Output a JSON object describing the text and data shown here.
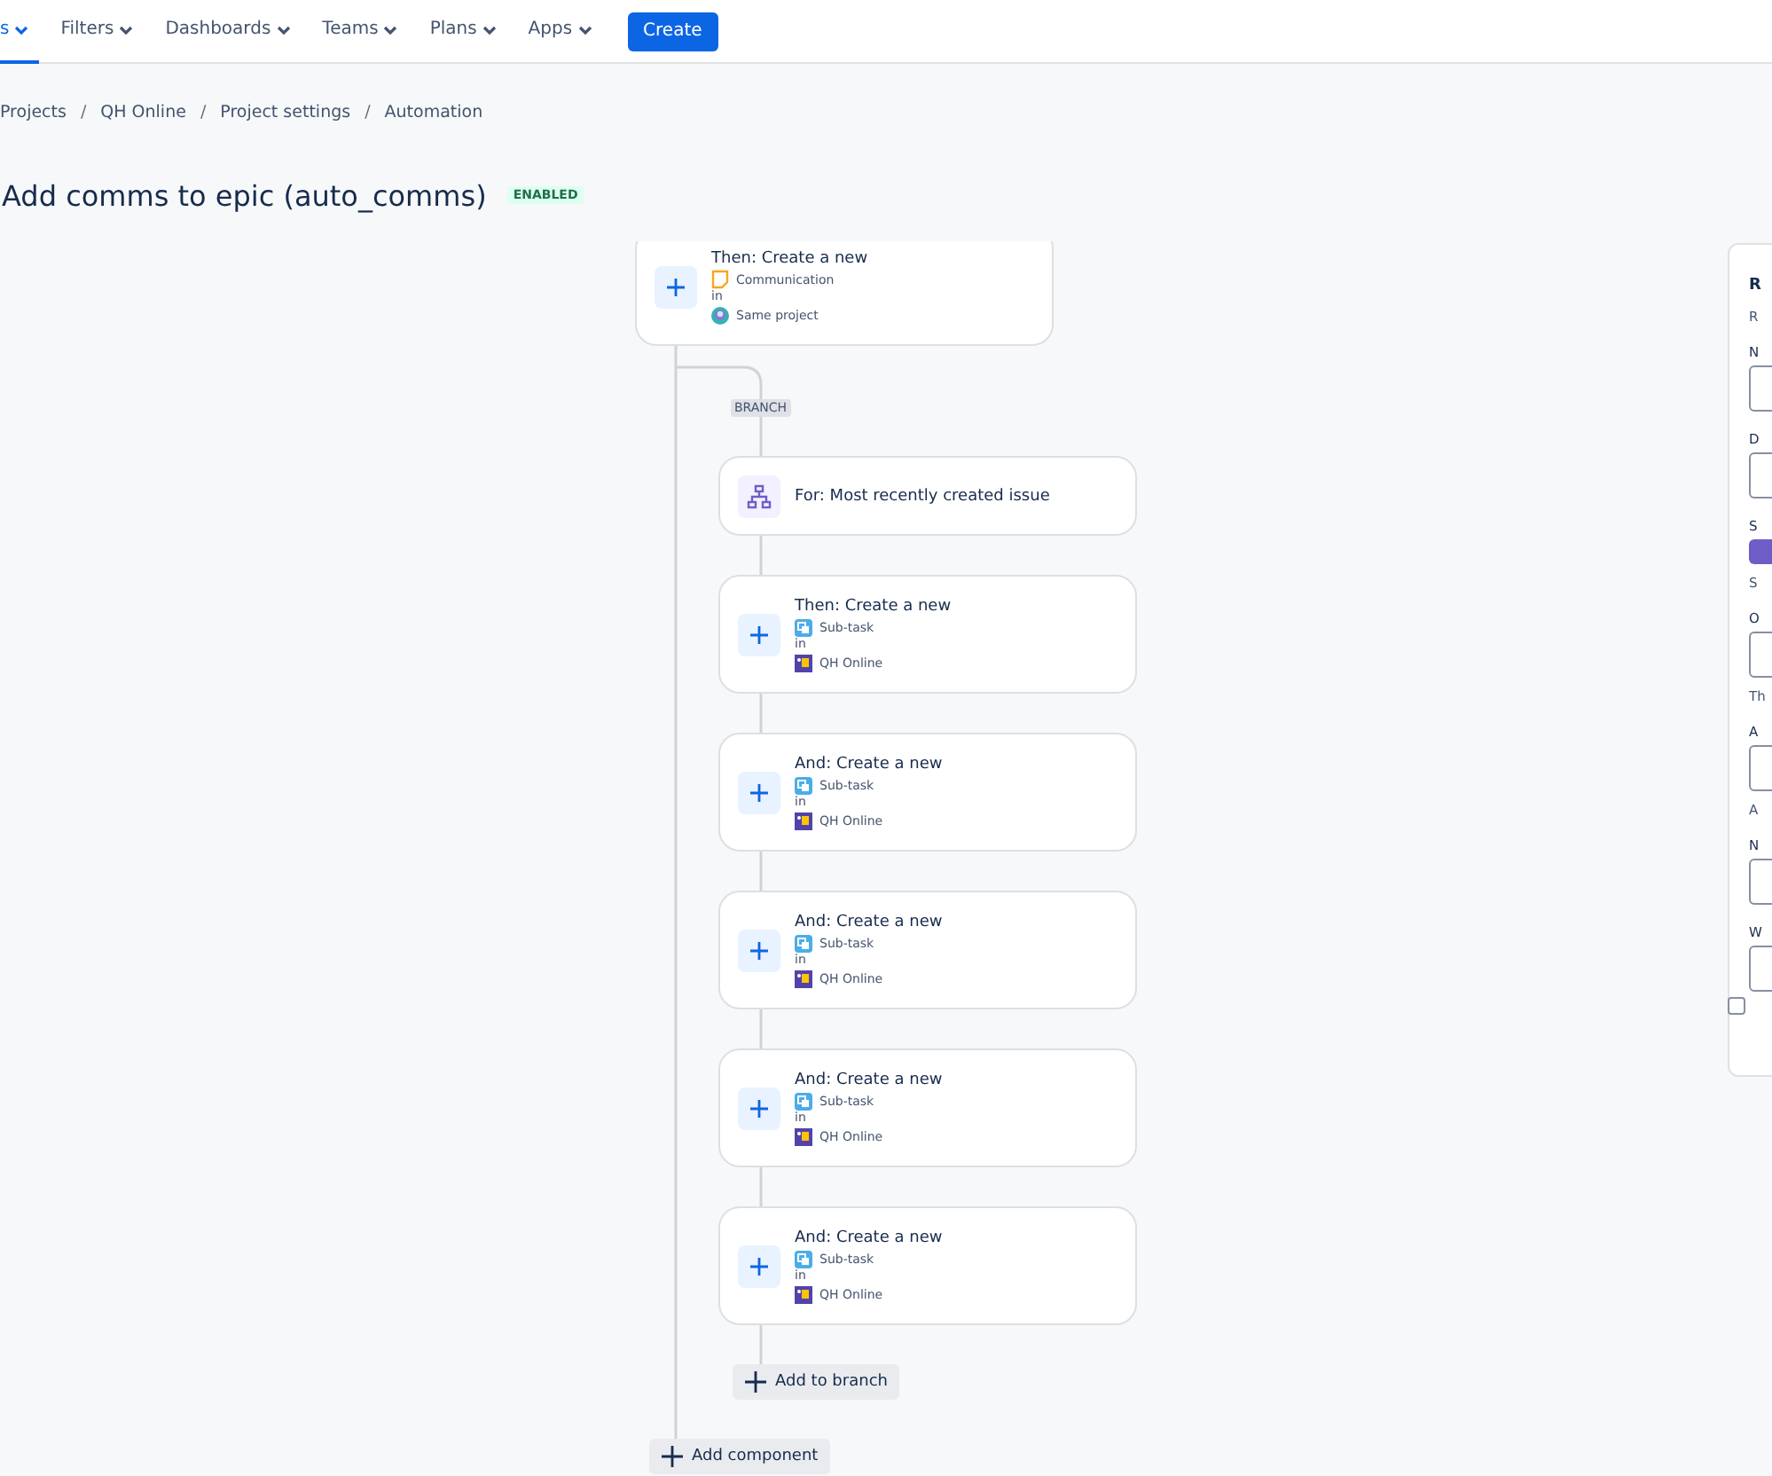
{
  "nav": {
    "items": [
      {
        "label": "s",
        "selected": true
      },
      {
        "label": "Filters",
        "selected": false
      },
      {
        "label": "Dashboards",
        "selected": false
      },
      {
        "label": "Teams",
        "selected": false
      },
      {
        "label": "Plans",
        "selected": false
      },
      {
        "label": "Apps",
        "selected": false
      }
    ],
    "create_button": "Create"
  },
  "breadcrumbs": [
    "Projects",
    "QH Online",
    "Project settings",
    "Automation"
  ],
  "breadcrumb_separator": "/",
  "title": "Add comms to epic (auto_comms)",
  "status": "ENABLED",
  "flow": {
    "trigger_card": {
      "title": "Then: Create a new",
      "issue_type": "Communication",
      "in": "in",
      "project": "Same project"
    },
    "branch": {
      "label": "BRANCH",
      "for_card": "For: Most recently created issue",
      "actions": [
        {
          "title": "Then: Create a new",
          "issue_type": "Sub-task",
          "in": "in",
          "project": "QH Online"
        },
        {
          "title": "And: Create a new",
          "issue_type": "Sub-task",
          "in": "in",
          "project": "QH Online"
        },
        {
          "title": "And: Create a new",
          "issue_type": "Sub-task",
          "in": "in",
          "project": "QH Online"
        },
        {
          "title": "And: Create a new",
          "issue_type": "Sub-task",
          "in": "in",
          "project": "QH Online"
        },
        {
          "title": "And: Create a new",
          "issue_type": "Sub-task",
          "in": "in",
          "project": "QH Online"
        }
      ],
      "add_button": "Add to branch"
    },
    "add_component": "Add component"
  },
  "side_panel": {
    "items": [
      {
        "kind": "heading",
        "text": "R"
      },
      {
        "kind": "text",
        "text": "R"
      },
      {
        "kind": "label",
        "text": "N"
      },
      {
        "kind": "field"
      },
      {
        "kind": "label",
        "text": "D"
      },
      {
        "kind": "textarea"
      },
      {
        "kind": "label",
        "text": "S"
      },
      {
        "kind": "toggle",
        "on": true
      },
      {
        "kind": "hint",
        "text": "S"
      },
      {
        "kind": "label",
        "text": "O"
      },
      {
        "kind": "textarea"
      },
      {
        "kind": "hint",
        "text": "Th"
      },
      {
        "kind": "label",
        "text": "A"
      },
      {
        "kind": "textarea"
      },
      {
        "kind": "hint",
        "text": "A"
      },
      {
        "kind": "label",
        "text": "N"
      },
      {
        "kind": "textarea"
      },
      {
        "kind": "label",
        "text": "W"
      },
      {
        "kind": "textarea"
      },
      {
        "kind": "checkbox",
        "checked": false
      }
    ]
  }
}
